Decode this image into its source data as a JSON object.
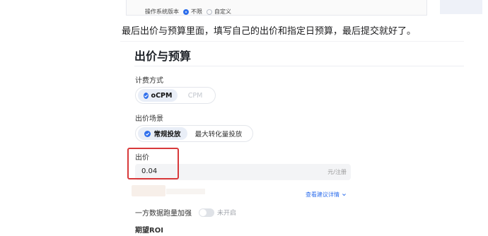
{
  "os_version": {
    "label": "操作系统版本",
    "options": [
      {
        "label": "不限",
        "selected": true
      },
      {
        "label": "自定义",
        "selected": false
      }
    ]
  },
  "caption": "最后出价与预算里面，填写自己的出价和指定日预算，最后提交就好了。",
  "section": {
    "title": "出价与预算",
    "billing": {
      "label": "计费方式",
      "options": [
        {
          "label": "oCPM",
          "state": "active"
        },
        {
          "label": "CPM",
          "state": "disabled"
        }
      ]
    },
    "scene": {
      "label": "出价场景",
      "options": [
        {
          "label": "常规投放",
          "state": "active"
        },
        {
          "label": "最大转化量投放",
          "state": "normal"
        }
      ]
    },
    "bid": {
      "label": "出价",
      "value": "0.04",
      "unit": "元/注册"
    },
    "suggestion_link": "查看建议详情",
    "first_party": {
      "label": "一方数据跑量加强",
      "state": "未开启",
      "enabled": false
    },
    "roi_label": "期望ROI"
  },
  "colors": {
    "accent": "#2f6fec",
    "highlight_box": "#d8393b"
  }
}
